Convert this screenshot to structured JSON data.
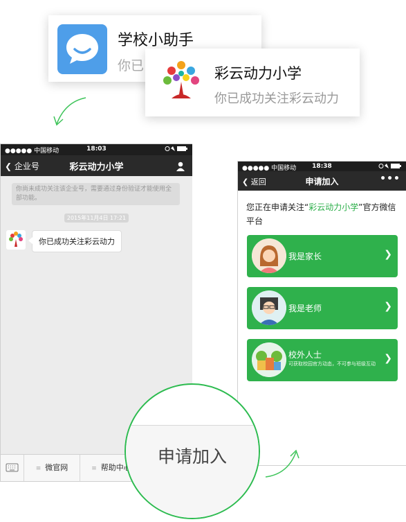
{
  "card1": {
    "title": "学校小助手",
    "subtitle": "你已",
    "icon": "chat-bubble-smile-icon",
    "icon_color": "#4e9ee9"
  },
  "card2": {
    "title": "彩云动力小学",
    "subtitle": "你已成功关注彩云动力",
    "logo": "school-tree-logo"
  },
  "phone1": {
    "status": {
      "carrier": "●●●●● 中国移动",
      "time": "18:03"
    },
    "nav": {
      "back_label": "企业号",
      "title": "彩云动力小学",
      "person_icon": "person-icon"
    },
    "notice": "你尚未成功关注该企业号，需要通过身份验证才能使用全部功能。",
    "timestamp": "2015年11月4日 17:21",
    "message": "你已成功关注彩云动力",
    "menu": [
      {
        "label": "微官网"
      },
      {
        "label": "帮助中心"
      }
    ]
  },
  "phone2": {
    "status": {
      "carrier": "●●●●● 中国移动",
      "time": "18:38"
    },
    "nav": {
      "back_label": "返回",
      "title": "申请加入",
      "more": "•••"
    },
    "intro_prefix": "您正在申请关注“",
    "intro_highlight": "彩云动力小学",
    "intro_suffix": "”官方微信平台",
    "roles": [
      {
        "label": "我是家长",
        "icon": "parent-avatar-icon"
      },
      {
        "label": "我是老师",
        "icon": "teacher-avatar-icon"
      },
      {
        "label": "校外人士",
        "desc": "可获取校园官方动态，不可参与班级互动",
        "icon": "houses-icon"
      }
    ],
    "accent": "#2fb14c"
  },
  "magnifier": {
    "label": "申请加入"
  }
}
